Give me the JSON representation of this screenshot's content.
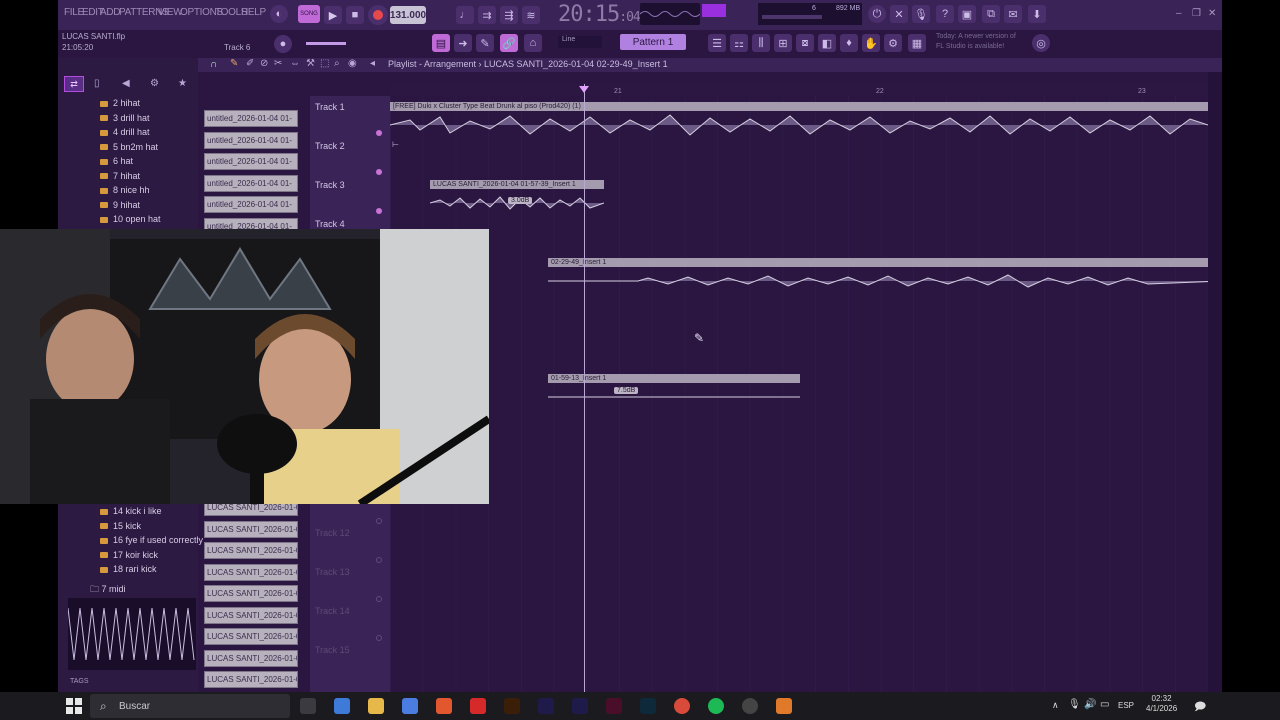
{
  "menu": [
    "FILE",
    "EDIT",
    "ADD",
    "PATTERNS",
    "VIEW",
    "OPTIONS",
    "TOOLS",
    "HELP"
  ],
  "project": {
    "name": "LUCAS SANTI.flp",
    "time": "21:05:20",
    "track_hint": "Track 6"
  },
  "transport": {
    "tempo": "131.000",
    "clock_main": "20:15",
    "clock_sub": "04",
    "mem": "892 MB",
    "cpu_count": "6"
  },
  "pattern_label": "Pattern 1",
  "snap_label": "Line",
  "news": "Today: A newer version of FL Studio is available!",
  "playlist_title": "Playlist - Arrangement",
  "playlist_subtitle": "LUCAS SANTI_2026-01-04 02-29-49_Insert 1",
  "ruler": [
    "21",
    "22",
    "23"
  ],
  "browser": {
    "items_top": [
      "2 hihat",
      "3 drill hat",
      "4 drill hat",
      "5 bn2m hat",
      "6 hat",
      "7 hihat",
      "8 nice hh",
      "9 hihat",
      "10 open hat"
    ],
    "items_bottom": [
      "14 kick i like",
      "15 kick",
      "16 fye if used correctly",
      "17 koir kick",
      "18 rari kick"
    ],
    "midi_folder": "7 midi",
    "tags": "TAGS"
  },
  "clip_list_top": [
    "untitled_2026-01-04 01-",
    "untitled_2026-01-04 01-",
    "untitled_2026-01-04 01-",
    "untitled_2026-01-04 01-",
    "untitled_2026-01-04 01-",
    "untitled_2026-01-04 01-"
  ],
  "clip_list_bottom": [
    "LUCAS SANTI_2026-01-04..",
    "LUCAS SANTI_2026-01-04..",
    "LUCAS SANTI_2026-01-04..",
    "LUCAS SANTI_2026-01-04..",
    "LUCAS SANTI_2026-01-04..",
    "LUCAS SANTI_2026-01-04..",
    "LUCAS SANTI_2026-01-04..",
    "LUCAS SANTI_2026-01-04..",
    "LUCAS SANTI_2026-01-04.."
  ],
  "tracks": [
    "Track 1",
    "Track 2",
    "Track 3",
    "Track 4"
  ],
  "tracks_bottom": [
    "Track 12",
    "Track 13",
    "Track 14",
    "Track 15"
  ],
  "clips": {
    "track1": "[FREE] Duki x Cluster Type Beat Drunk al piso (Prod420) (1)",
    "track3": "LUCAS SANTI_2026-01-04 01-57-39_Insert 1",
    "track3_gain": "3.0dB",
    "track5": "02-29-49_Insert 1",
    "track8": "01-59-13_Insert 1",
    "track8_gain": "7.5dB"
  },
  "taskbar": {
    "search_placeholder": "Buscar",
    "lang": "ESP",
    "time": "02:32",
    "date": "4/1/2026"
  },
  "colors": {
    "fl_bg": "#2a1640",
    "clip_gray": "#a49cae",
    "accent_purple": "#9a2fe0",
    "record_red": "#e5484d"
  }
}
